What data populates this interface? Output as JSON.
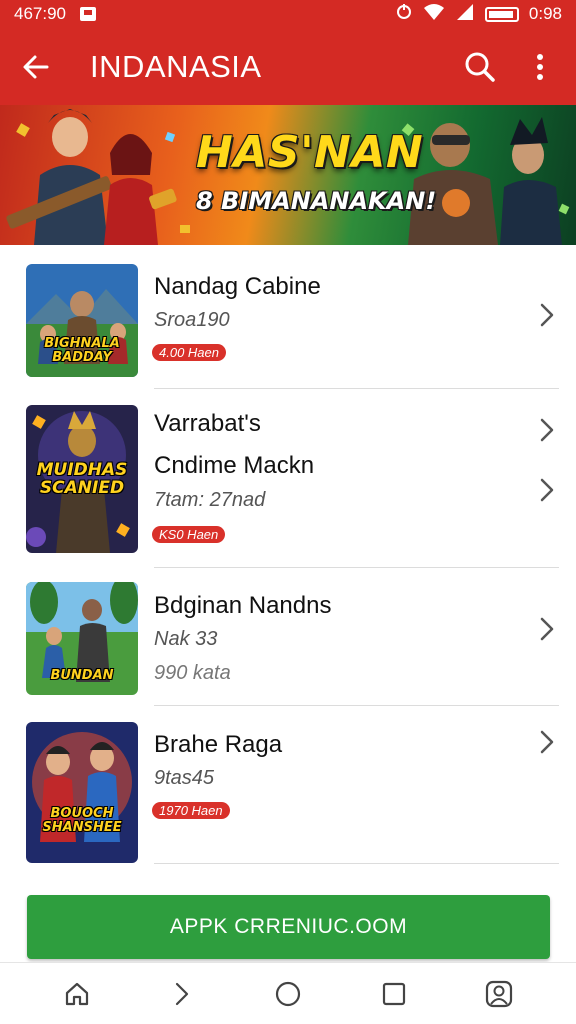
{
  "status_bar": {
    "time_left": "467:90",
    "time_right": "0:98",
    "icons": [
      "sim-card-icon",
      "sync-icon",
      "wifi-icon",
      "signal-icon",
      "battery-icon"
    ]
  },
  "app_bar": {
    "title": "INDANASIA",
    "icons": [
      "back-arrow-icon",
      "search-icon",
      "more-vert-icon"
    ]
  },
  "banner": {
    "headline": "HAS'NAN",
    "subline": "8 BIMANANAKAN!"
  },
  "list": {
    "items": [
      {
        "title": "Nandag Cabine",
        "subtitle": "Sroa190",
        "badge": "4.00 Haen",
        "thumb_caption": "BIGHNALA BADDAY"
      },
      {
        "title": "Varrabat's",
        "title2": "Cndime Mackn",
        "subtitle": "7tam: 27nad",
        "badge": "KS0 Haen",
        "thumb_caption": "MUIDHAS SCANIED"
      },
      {
        "title": "Bdginan Nandns",
        "subtitle": "Nak 33",
        "subtitle2": "990 kata",
        "thumb_caption": "BUNDAN"
      },
      {
        "title": "Brahe Raga",
        "subtitle": "9tas45",
        "badge": "1970 Haen",
        "thumb_caption": "BOUOCH SHANSHEE"
      }
    ]
  },
  "cta": {
    "label": "APPK CRRENIUC.OOM"
  },
  "nav": {
    "icons": [
      "home-icon",
      "forward-icon",
      "circle-home-icon",
      "recents-square-icon",
      "profile-icon"
    ]
  },
  "colors": {
    "primary": "#d42a24",
    "cta": "#2e9e3e",
    "badge": "#d9312a"
  }
}
